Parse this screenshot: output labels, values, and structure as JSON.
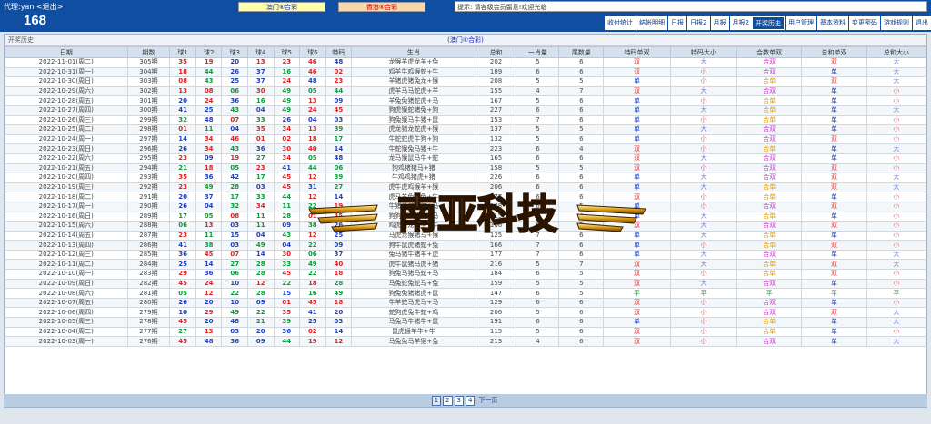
{
  "header": {
    "agent_label": "代理:yan  <退出>",
    "brand": "168",
    "btn_macau": "澳门⑥合彩",
    "btn_hk": "香港⑥合彩",
    "notice": "提示:  请各级会员留意!欢迎光临"
  },
  "nav": [
    "收付统计",
    "结帐明细",
    "日报",
    "日报2",
    "月报",
    "月报2",
    "开奖历史",
    "用户管理",
    "基本资料",
    "变更密码",
    "游戏规则",
    "退出"
  ],
  "nav_active": 6,
  "panel": {
    "section": "开奖历史",
    "title": "(澳门⑥合彩)"
  },
  "columns": [
    "日期",
    "期数",
    "球1",
    "球2",
    "球3",
    "球4",
    "球5",
    "球6",
    "特码",
    "生肖",
    "总和",
    "一肖量",
    "尾数量",
    "特码单双",
    "特码大小",
    "合数单双",
    "总和单双",
    "总和大小"
  ],
  "rows": [
    [
      "2022-11-01(周二)",
      "305期",
      "35",
      "19",
      "20",
      "13",
      "23",
      "46",
      "48",
      "龙猴羊虎龙羊+兔",
      "202",
      "5",
      "6",
      "双",
      "大",
      "合双",
      "双",
      "大"
    ],
    [
      "2022-10-31(周一)",
      "304期",
      "18",
      "44",
      "26",
      "37",
      "16",
      "46",
      "02",
      "鸡羊牛鸡猴蛇+牛",
      "189",
      "6",
      "6",
      "双",
      "小",
      "合双",
      "单",
      "大"
    ],
    [
      "2022-10-30(周日)",
      "303期",
      "08",
      "43",
      "25",
      "37",
      "24",
      "48",
      "23",
      "羊猪虎猪兔龙+猴",
      "208",
      "5",
      "5",
      "单",
      "小",
      "合单",
      "双",
      "大"
    ],
    [
      "2022-10-29(周六)",
      "302期",
      "13",
      "08",
      "06",
      "30",
      "49",
      "05",
      "44",
      "虎羊马马蛇虎+羊",
      "155",
      "4",
      "7",
      "双",
      "大",
      "合双",
      "单",
      "小"
    ],
    [
      "2022-10-28(周五)",
      "301期",
      "20",
      "24",
      "36",
      "16",
      "49",
      "13",
      "09",
      "羊兔兔猪蛇虎+马",
      "167",
      "5",
      "6",
      "单",
      "小",
      "合单",
      "单",
      "小"
    ],
    [
      "2022-10-27(周四)",
      "300期",
      "41",
      "25",
      "43",
      "04",
      "49",
      "24",
      "45",
      "狗虎猴蛇猪兔+狗",
      "227",
      "6",
      "6",
      "单",
      "大",
      "合单",
      "单",
      "大"
    ],
    [
      "2022-10-26(周三)",
      "299期",
      "32",
      "48",
      "07",
      "33",
      "26",
      "04",
      "03",
      "狗兔猴马牛猪+鼠",
      "153",
      "7",
      "6",
      "单",
      "小",
      "合单",
      "单",
      "小"
    ],
    [
      "2022-10-25(周二)",
      "298期",
      "01",
      "11",
      "04",
      "35",
      "34",
      "13",
      "39",
      "虎龙猪龙蛇虎+猴",
      "137",
      "5",
      "5",
      "单",
      "大",
      "合双",
      "单",
      "小"
    ],
    [
      "2022-10-24(周一)",
      "297期",
      "14",
      "34",
      "46",
      "01",
      "02",
      "18",
      "17",
      "牛蛇蛇虎牛狗+狗",
      "132",
      "5",
      "6",
      "单",
      "小",
      "合双",
      "双",
      "小"
    ],
    [
      "2022-10-23(周日)",
      "296期",
      "26",
      "34",
      "43",
      "36",
      "30",
      "40",
      "14",
      "牛蛇猴兔马猪+牛",
      "223",
      "6",
      "4",
      "双",
      "小",
      "合单",
      "单",
      "大"
    ],
    [
      "2022-10-22(周六)",
      "295期",
      "23",
      "09",
      "19",
      "27",
      "34",
      "05",
      "48",
      "龙马猴鼠马牛+蛇",
      "165",
      "6",
      "6",
      "双",
      "大",
      "合双",
      "单",
      "小"
    ],
    [
      "2022-10-21(周五)",
      "294期",
      "21",
      "18",
      "05",
      "23",
      "41",
      "44",
      "06",
      "狗鸡猪猪马+猪",
      "158",
      "5",
      "5",
      "双",
      "小",
      "合双",
      "双",
      "小"
    ],
    [
      "2022-10-20(周四)",
      "293期",
      "35",
      "36",
      "42",
      "17",
      "45",
      "12",
      "39",
      "牛鸡鸡猪虎+猪",
      "226",
      "6",
      "6",
      "单",
      "大",
      "合双",
      "双",
      "大"
    ],
    [
      "2022-10-19(周三)",
      "292期",
      "23",
      "49",
      "28",
      "03",
      "45",
      "31",
      "27",
      "虎牛虎鸡猴羊+猴",
      "206",
      "6",
      "6",
      "单",
      "大",
      "合单",
      "双",
      "大"
    ],
    [
      "2022-10-18(周二)",
      "291期",
      "20",
      "37",
      "17",
      "33",
      "44",
      "12",
      "14",
      "虎马羊兔牛兔+牛",
      "177",
      "6",
      "6",
      "双",
      "小",
      "合单",
      "单",
      "小"
    ],
    [
      "2022-10-17(周一)",
      "290期",
      "26",
      "04",
      "32",
      "34",
      "11",
      "22",
      "19",
      "牛猪羊蛇龙蛇+马",
      "148",
      "6",
      "5",
      "单",
      "小",
      "合双",
      "双",
      "小"
    ],
    [
      "2022-10-16(周日)",
      "289期",
      "17",
      "05",
      "08",
      "11",
      "28",
      "01",
      "45",
      "狗狗羊龙猪虎+马",
      "115",
      "6",
      "4",
      "单",
      "大",
      "合单",
      "单",
      "小"
    ],
    [
      "2022-10-15(周六)",
      "288期",
      "06",
      "13",
      "03",
      "11",
      "09",
      "38",
      "26",
      "鸡虎猴龙马牛+牛",
      "106",
      "6",
      "5",
      "双",
      "大",
      "合双",
      "双",
      "小"
    ],
    [
      "2022-10-14(周五)",
      "287期",
      "23",
      "11",
      "15",
      "04",
      "43",
      "12",
      "25",
      "马虎龙猴猪马+猴",
      "125",
      "7",
      "6",
      "单",
      "大",
      "合单",
      "单",
      "小"
    ],
    [
      "2022-10-13(周四)",
      "286期",
      "41",
      "38",
      "03",
      "49",
      "04",
      "22",
      "09",
      "狗牛鼠虎猪蛇+兔",
      "166",
      "7",
      "6",
      "单",
      "小",
      "合单",
      "双",
      "小"
    ],
    [
      "2022-10-12(周三)",
      "285期",
      "36",
      "45",
      "07",
      "14",
      "30",
      "06",
      "37",
      "兔马猪牛猪羊+虎",
      "177",
      "7",
      "6",
      "单",
      "大",
      "合双",
      "单",
      "大"
    ],
    [
      "2022-10-11(周二)",
      "284期",
      "25",
      "14",
      "27",
      "28",
      "33",
      "49",
      "40",
      "虎牛鼠猪马虎+猪",
      "216",
      "5",
      "7",
      "双",
      "大",
      "合单",
      "双",
      "大"
    ],
    [
      "2022-10-10(周一)",
      "283期",
      "29",
      "36",
      "06",
      "28",
      "45",
      "22",
      "18",
      "狗兔马猪马蛇+马",
      "184",
      "6",
      "5",
      "双",
      "小",
      "合单",
      "双",
      "小"
    ],
    [
      "2022-10-09(周日)",
      "282期",
      "45",
      "24",
      "10",
      "12",
      "22",
      "18",
      "28",
      "马兔蛇兔蛇马+兔",
      "159",
      "5",
      "5",
      "双",
      "大",
      "合双",
      "单",
      "小"
    ],
    [
      "2022-10-08(周六)",
      "281期",
      "05",
      "12",
      "22",
      "28",
      "15",
      "16",
      "49",
      "狗兔兔猪猪虎+鼠",
      "147",
      "6",
      "5",
      "平",
      "平",
      "平",
      "平",
      "平"
    ],
    [
      "2022-10-07(周五)",
      "280期",
      "26",
      "20",
      "10",
      "09",
      "01",
      "45",
      "18",
      "牛羊蛇马虎马+马",
      "129",
      "6",
      "6",
      "双",
      "小",
      "合双",
      "单",
      "小"
    ],
    [
      "2022-10-06(周四)",
      "279期",
      "10",
      "29",
      "49",
      "22",
      "35",
      "41",
      "20",
      "蛇狗虎兔牛蛇+鸡",
      "206",
      "5",
      "6",
      "双",
      "小",
      "合双",
      "双",
      "大"
    ],
    [
      "2022-10-05(周三)",
      "278期",
      "45",
      "20",
      "48",
      "21",
      "39",
      "25",
      "03",
      "马兔马牛猪牛+鼠",
      "191",
      "6",
      "6",
      "单",
      "小",
      "合单",
      "单",
      "大"
    ],
    [
      "2022-10-04(周二)",
      "277期",
      "27",
      "13",
      "03",
      "20",
      "36",
      "02",
      "14",
      "鼠虎猴羊牛+牛",
      "115",
      "5",
      "6",
      "双",
      "小",
      "合单",
      "单",
      "小"
    ],
    [
      "2022-10-03(周一)",
      "276期",
      "45",
      "48",
      "36",
      "09",
      "44",
      "19",
      "12",
      "马兔兔马羊猴+兔",
      "213",
      "4",
      "6",
      "双",
      "小",
      "合双",
      "单",
      "大"
    ]
  ],
  "pager": {
    "pages": [
      "1",
      "2",
      "3",
      "4"
    ],
    "current": 0,
    "next": "下一页"
  },
  "watermark": "南亚科技",
  "colors": {
    "header_bg": "#0f4ea0",
    "red_ball": "#e02020",
    "blue_ball": "#2040c0",
    "green_ball": "#0a9a3a"
  }
}
